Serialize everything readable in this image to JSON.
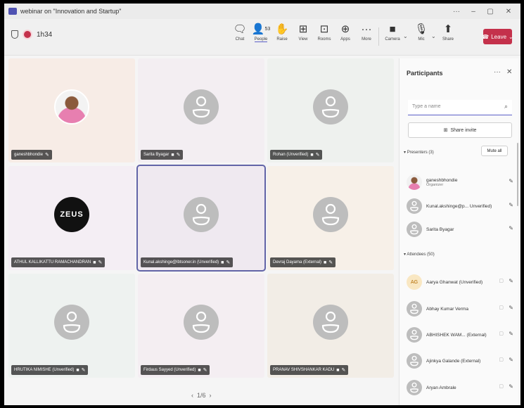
{
  "window": {
    "title": "webinar on \"Innovation and Startup\"",
    "controls": [
      "···",
      "–",
      "▢",
      "✕"
    ]
  },
  "toolbar": {
    "timer": "1h34",
    "buttons": [
      {
        "label": "Chat",
        "icon": "chat-icon",
        "glyph": "🗨"
      },
      {
        "label": "People",
        "icon": "people-icon",
        "glyph": "👤",
        "count": "53"
      },
      {
        "label": "Raise",
        "icon": "raise-hand-icon",
        "glyph": "✋"
      },
      {
        "label": "View",
        "icon": "view-icon",
        "glyph": "⊞"
      },
      {
        "label": "Rooms",
        "icon": "rooms-icon",
        "glyph": "⊡"
      },
      {
        "label": "Apps",
        "icon": "apps-icon",
        "glyph": "⊕"
      },
      {
        "label": "More",
        "icon": "more-icon",
        "glyph": "···"
      },
      {
        "label": "Camera",
        "icon": "camera-off-icon",
        "glyph": "■"
      },
      {
        "label": "Mic",
        "icon": "mic-off-icon",
        "glyph": "🎙"
      },
      {
        "label": "Share",
        "icon": "share-icon",
        "glyph": "⬆"
      }
    ],
    "leave_label": "Leave"
  },
  "tiles": [
    {
      "name": "ganeshbhondie",
      "kind": "photo",
      "bg": "#f7ece6"
    },
    {
      "name": "Sarita Byagar",
      "kind": "avatar",
      "bg": "#f3eef2"
    },
    {
      "name": "Rohan (Unverified)",
      "kind": "avatar",
      "bg": "#eef1ee"
    },
    {
      "name": "ATHUL KALLIKATTU RAMACHANDRAN",
      "kind": "zeus",
      "logo": "ZEUS",
      "bg": "#f4eef4"
    },
    {
      "name": "Kunal.akshinge@lbtsoner.in (Unverified)",
      "kind": "avatar",
      "bg": "#efe9f0",
      "active": true
    },
    {
      "name": "Devraj Dayama (External)",
      "kind": "avatar",
      "bg": "#f7f0e8"
    },
    {
      "name": "HRUTIKA NIMISHE (Unverified)",
      "kind": "avatar",
      "bg": "#eef2f0"
    },
    {
      "name": "Firdaus Sayyed (Unverified)",
      "kind": "avatar",
      "bg": "#f4eef2"
    },
    {
      "name": "PRANAV SHIVSHANKAR KADU",
      "kind": "avatar",
      "bg": "#f2ede6"
    }
  ],
  "pager": {
    "label": "1/6",
    "prev": "‹",
    "next": "›"
  },
  "panel": {
    "title": "Participants",
    "search_placeholder": "Type a name",
    "share_invite_label": "Share invite",
    "presenters_label": "Presenters (3)",
    "mute_all_label": "Mute all",
    "attendees_label": "Attendees (50)",
    "presenters": [
      {
        "name": "ganeshbhondie",
        "sub": "Organizer",
        "avatar": "photo"
      },
      {
        "name": "Kunal.akshinge@p... Unverified)",
        "sub": "",
        "avatar": "default"
      },
      {
        "name": "Sarita Byagar",
        "sub": "",
        "avatar": "default"
      }
    ],
    "attendees": [
      {
        "name": "Aarya Ghanwat (Unverified)",
        "initials": "AG"
      },
      {
        "name": "Abhay Kumar Verma",
        "initials": ""
      },
      {
        "name": "ABHISHEK WAM... (External)",
        "initials": ""
      },
      {
        "name": "Ajinkya Galande (External)",
        "initials": ""
      },
      {
        "name": "Aryan Ambrale",
        "initials": ""
      }
    ]
  }
}
